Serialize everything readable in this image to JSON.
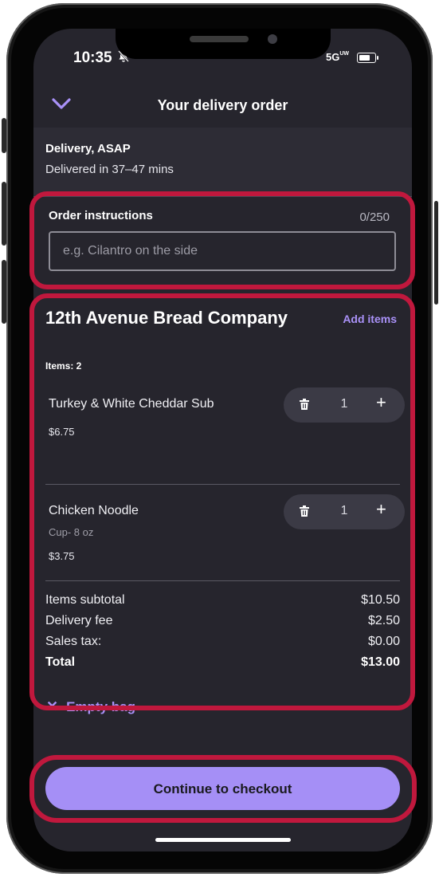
{
  "status_bar": {
    "time": "10:35",
    "network": "5G",
    "network_sub": "UW"
  },
  "header": {
    "title": "Your delivery order"
  },
  "delivery": {
    "title": "Delivery, ASAP",
    "subtitle": "Delivered in 37–47 mins"
  },
  "instructions": {
    "label": "Order instructions",
    "count": "0/250",
    "placeholder": "e.g. Cilantro on the side"
  },
  "restaurant": {
    "name": "12th Avenue Bread Company",
    "add_items": "Add items",
    "items_count": "Items: 2",
    "items": [
      {
        "name": "Turkey & White Cheddar Sub",
        "description": "",
        "price": "$6.75",
        "quantity": "1"
      },
      {
        "name": "Chicken Noodle",
        "description": "Cup- 8 oz",
        "price": "$3.75",
        "quantity": "1"
      }
    ]
  },
  "summary": {
    "rows": [
      {
        "label": "Items subtotal",
        "value": "$10.50"
      },
      {
        "label": "Delivery fee",
        "value": "$2.50"
      },
      {
        "label": "Sales tax:",
        "value": "$0.00"
      }
    ],
    "total_label": "Total",
    "total_value": "$13.00"
  },
  "empty_bag": "Empty bag",
  "checkout_button": "Continue to checkout",
  "colors": {
    "accent": "#a991f7",
    "button": "#a58ff6",
    "background": "#26252d",
    "highlight": "#c0183d"
  },
  "icons": [
    "chevron-down-icon",
    "bell-off-icon",
    "signal-icon",
    "battery-icon",
    "trash-icon",
    "plus-icon",
    "close-icon"
  ]
}
